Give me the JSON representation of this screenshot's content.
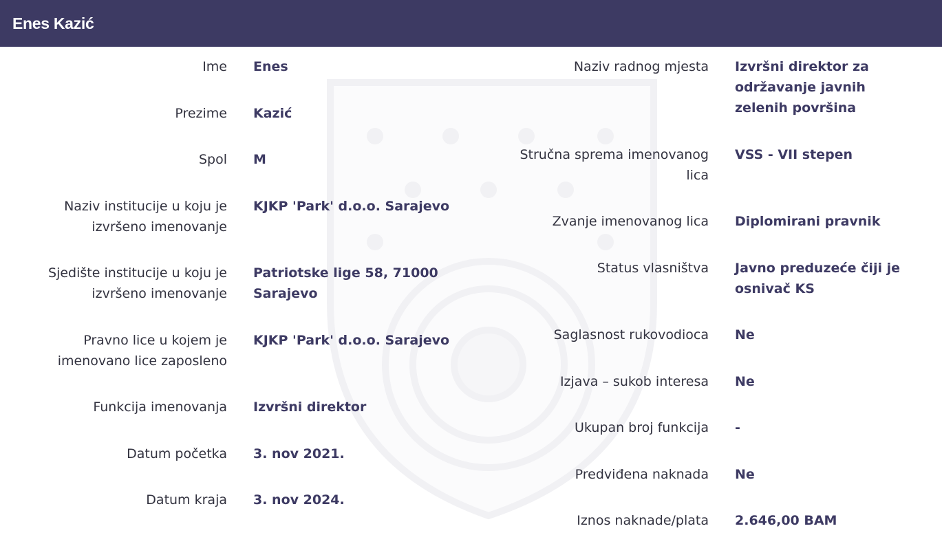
{
  "header": {
    "title": "Enes Kazić"
  },
  "left": [
    {
      "label": "Ime",
      "value": "Enes"
    },
    {
      "label": "Prezime",
      "value": "Kazić"
    },
    {
      "label": "Spol",
      "value": "M"
    },
    {
      "label": "Naziv institucije u koju je izvršeno imenovanje",
      "value": "KJKP 'Park' d.o.o. Sarajevo"
    },
    {
      "label": "Sjedište institucije u koju je izvršeno imenovanje",
      "value": "Patriotske lige 58, 71000 Sarajevo"
    },
    {
      "label": "Pravno lice u kojem je imenovano lice zaposleno",
      "value": "KJKP 'Park' d.o.o. Sarajevo"
    },
    {
      "label": "Funkcija imenovanja",
      "value": "Izvršni direktor"
    },
    {
      "label": "Datum početka",
      "value": "3. nov 2021."
    },
    {
      "label": "Datum kraja",
      "value": "3. nov 2024."
    }
  ],
  "right": [
    {
      "label": "Naziv radnog mjesta",
      "value": "Izvršni direktor za održavanje javnih zelenih površina"
    },
    {
      "label": "Stručna sprema imenovanog lica",
      "value": "VSS - VII stepen"
    },
    {
      "label": "Zvanje imenovanog lica",
      "value": "Diplomirani pravnik"
    },
    {
      "label": "Status vlasništva",
      "value": "Javno preduzeće čiji je osnivač KS"
    },
    {
      "label": "Saglasnost rukovodioca",
      "value": "Ne"
    },
    {
      "label": "Izjava – sukob interesa",
      "value": "Ne"
    },
    {
      "label": "Ukupan broj funkcija",
      "value": "-"
    },
    {
      "label": "Predviđena naknada",
      "value": "Ne"
    },
    {
      "label": "Iznos naknade/plata",
      "value": "2.646,00 BAM"
    }
  ],
  "colors": {
    "header_bg": "#3d3a63",
    "value_text": "#3d3a63",
    "label_text": "#333340"
  },
  "watermark": {
    "icon": "sarajevo-coat-of-arms-icon"
  }
}
